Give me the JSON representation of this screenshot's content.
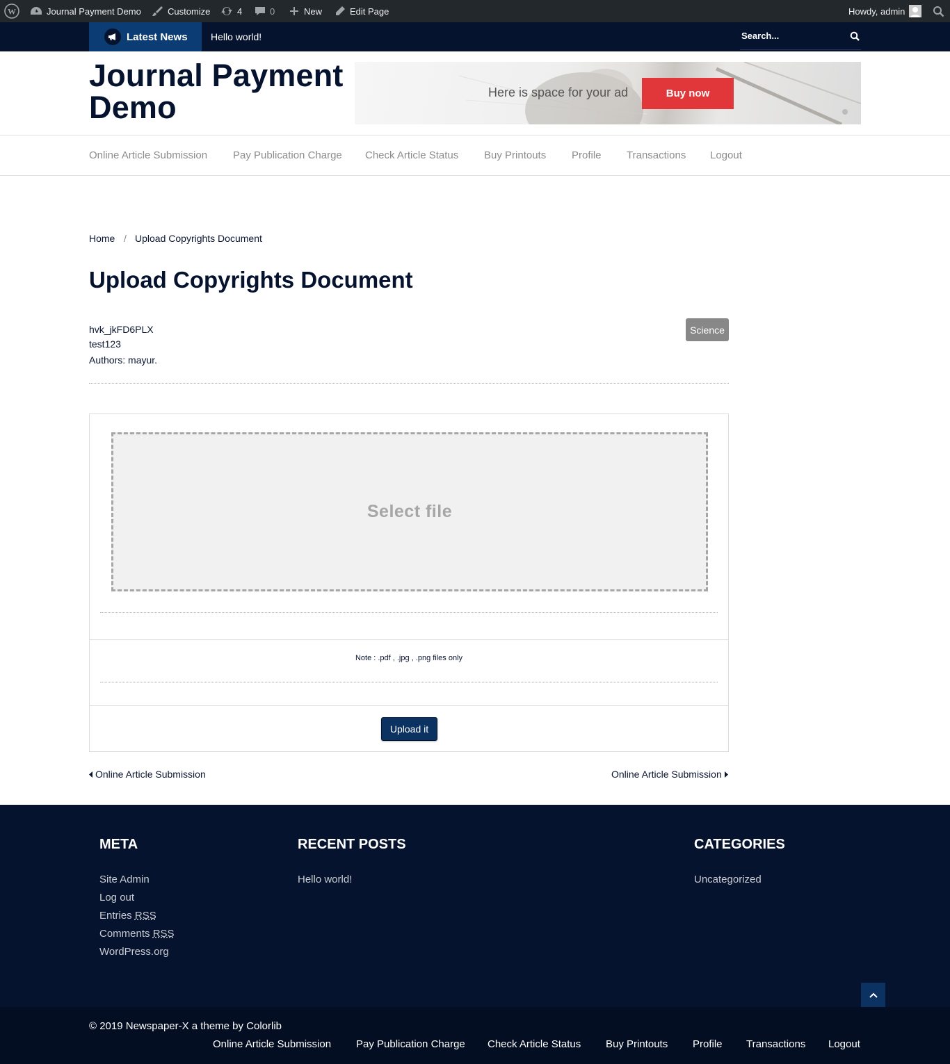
{
  "admin_bar": {
    "site_name": "Journal Payment Demo",
    "customize": "Customize",
    "updates_count": "4",
    "comments_count": "0",
    "new_label": "New",
    "edit_page": "Edit Page",
    "howdy": "Howdy, admin"
  },
  "news_bar": {
    "latest_label": "Latest News",
    "ticker_item": "Hello world!",
    "search_placeholder": "Search..."
  },
  "header": {
    "logo": "Journal Payment Demo",
    "ad_text": "Here is space for your ad",
    "ad_button": "Buy now"
  },
  "nav": {
    "items": [
      "Online Article Submission",
      "Pay Publication Charge",
      "Check Article Status",
      "Buy Printouts",
      "Profile",
      "Transactions",
      "Logout"
    ]
  },
  "breadcrumb": {
    "home": "Home",
    "separator": "/",
    "current": "Upload Copyrights Document"
  },
  "page": {
    "title": "Upload Copyrights Document",
    "article_id": "hvk_jkFD6PLX",
    "article_name": "test123",
    "authors": "Authors: mayur.",
    "category_badge": "Science"
  },
  "upload": {
    "dropzone_label": "Select file",
    "note": "Note : .pdf , .jpg , .png files only",
    "button": "Upload it"
  },
  "post_nav": {
    "prev": "Online Article Submission",
    "next": "Online Article Submission"
  },
  "footer": {
    "meta_title": "META",
    "meta_links": {
      "site_admin": "Site Admin",
      "log_out": "Log out",
      "entries_pre": "Entries ",
      "comments_pre": "Comments ",
      "rss": "RSS",
      "wordpress": "WordPress.org"
    },
    "recent_title": "RECENT POSTS",
    "recent_posts": [
      "Hello world!"
    ],
    "categories_title": "CATEGORIES",
    "categories": [
      "Uncategorized"
    ],
    "copyright": "© 2019 Newspaper-X a theme by Colorlib",
    "bottom_links": [
      "Online Article Submission",
      "Pay Publication Charge",
      "Check Article Status",
      "Buy Printouts",
      "Profile",
      "Transactions",
      "Logout"
    ]
  },
  "colors": {
    "navy": "#06132e",
    "accent_blue": "#0c3c74",
    "ad_button": "#e1373b",
    "badge_gray": "#888888"
  }
}
